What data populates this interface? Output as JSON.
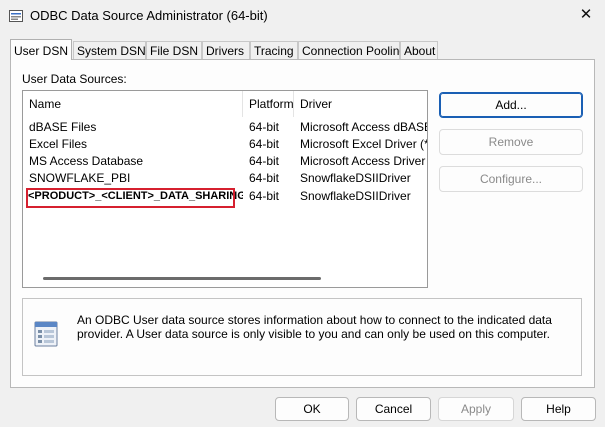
{
  "window": {
    "title": "ODBC Data Source Administrator (64-bit)",
    "close_glyph": "✕",
    "icon": "odbc-app-icon"
  },
  "tabs": [
    {
      "label": "User DSN",
      "active": true
    },
    {
      "label": "System DSN",
      "active": false
    },
    {
      "label": "File DSN",
      "active": false
    },
    {
      "label": "Drivers",
      "active": false
    },
    {
      "label": "Tracing",
      "active": false
    },
    {
      "label": "Connection Pooling",
      "active": false
    },
    {
      "label": "About",
      "active": false
    }
  ],
  "user_dsn": {
    "section_label": "User Data Sources:",
    "columns": {
      "name": "Name",
      "platform": "Platform",
      "driver": "Driver"
    },
    "rows": [
      {
        "name": "dBASE Files",
        "platform": "64-bit",
        "driver": "Microsoft Access dBASE D"
      },
      {
        "name": "Excel Files",
        "platform": "64-bit",
        "driver": "Microsoft Excel Driver (*.xls"
      },
      {
        "name": "MS Access Database",
        "platform": "64-bit",
        "driver": "Microsoft Access Driver (*."
      },
      {
        "name": "SNOWFLAKE_PBI",
        "platform": "64-bit",
        "driver": "SnowflakeDSIIDriver"
      },
      {
        "name": "<PRODUCT>_<CLIENT>_DATA_SHARING",
        "platform": "64-bit",
        "driver": "SnowflakeDSIIDriver"
      }
    ],
    "buttons": {
      "add": "Add...",
      "remove": "Remove",
      "configure": "Configure..."
    },
    "info_text": "An ODBC User data source stores information about how to connect to the indicated data provider.   A User data source is only visible to you and can only be used on this computer.",
    "info_icon": "data-source-icon",
    "highlight_color": "#d6202f"
  },
  "footer": {
    "ok": "OK",
    "cancel": "Cancel",
    "apply": "Apply",
    "help": "Help"
  }
}
